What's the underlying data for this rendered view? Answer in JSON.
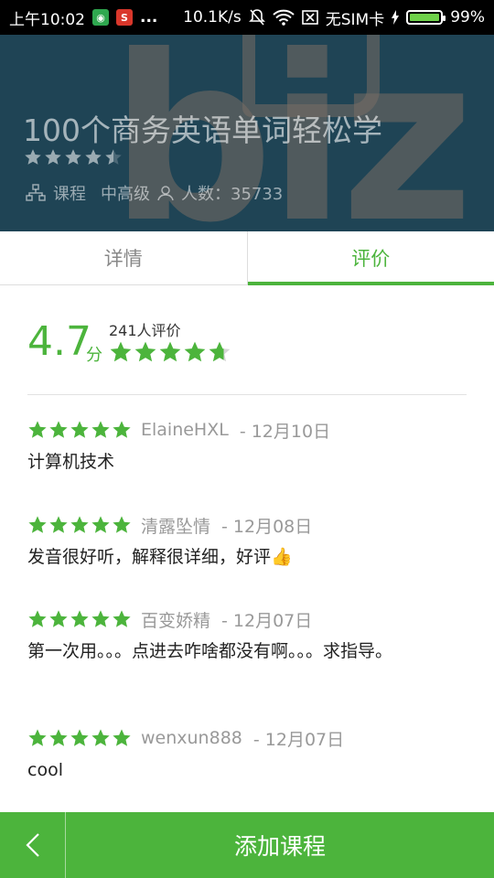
{
  "status_bar": {
    "time": "上午10:02",
    "more": "...",
    "net_speed": "10.1K/s",
    "sim": "无SIM卡",
    "battery_pct": "99%",
    "battery_level": 0.99
  },
  "course": {
    "logo_text": "biz",
    "title": "100个商务英语单词轻松学",
    "rating_stars": 4.5,
    "type_label": "课程",
    "level": "中高级",
    "students_label": "人数：35733"
  },
  "tabs": [
    {
      "label": "详情",
      "active": false
    },
    {
      "label": "评价",
      "active": true
    }
  ],
  "summary": {
    "score": "4.7",
    "unit": "分",
    "count": "241人评价",
    "stars": 4.7
  },
  "reviews": [
    {
      "stars": 5,
      "user": "ElaineHXL",
      "date": "- 12月10日",
      "text": "计算机技术"
    },
    {
      "stars": 5,
      "user": "清露坠情",
      "date": "- 12月08日",
      "text": "发音很好听，解释很详细，好评👍"
    },
    {
      "stars": 5,
      "user": "百变娇精",
      "date": "- 12月07日",
      "text": "第一次用。。。点进去咋啥都没有啊。。。求指导。"
    },
    {
      "stars": 5,
      "user": "wenxun888",
      "date": "- 12月07日",
      "text": "cool"
    }
  ],
  "bottom_bar": {
    "add_label": "添加课程"
  },
  "colors": {
    "accent": "#4cb43c",
    "hero_bg": "#1f4455",
    "star_empty": "#d6d6d6"
  }
}
